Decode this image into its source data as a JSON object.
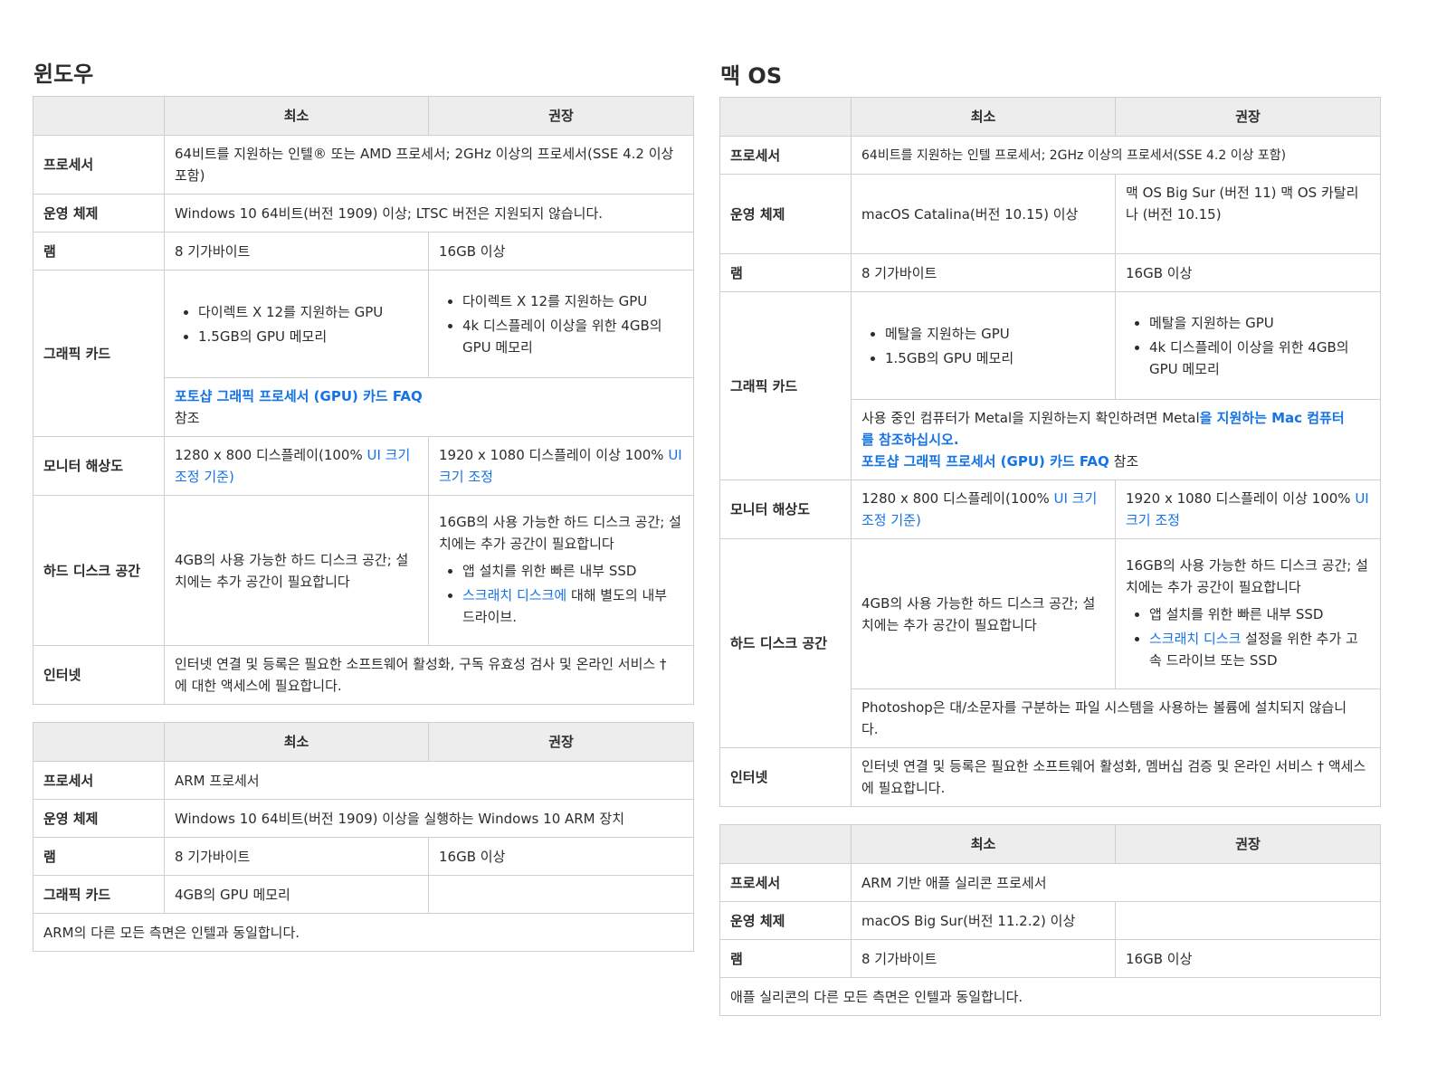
{
  "windows": {
    "heading": "윈도우",
    "col_min": "최소",
    "col_rec": "권장",
    "processor_label": "프로세서",
    "processor": "64비트를 지원하는 인텔® 또는 AMD 프로세서; 2GHz 이상의 프로세서(SSE 4.2 이상 포함)",
    "os_label": "운영 체제",
    "os": "Windows 10 64비트(버전 1909) 이상; LTSC 버전은 지원되지 않습니다.",
    "ram_label": "램",
    "ram_min": "8 기가바이트",
    "ram_rec": "16GB 이상",
    "gpu_label": "그래픽 카드",
    "gpu_min": [
      "다이렉트 X 12를 지원하는 GPU",
      "1.5GB의 GPU 메모리"
    ],
    "gpu_rec": [
      "다이렉트 X 12를 지원하는 GPU",
      "4k 디스플레이 이상을 위한 4GB의 GPU 메모리"
    ],
    "gpu_faq_link": "포토샵 그래픽 프로세서 (GPU) 카드 FAQ",
    "gpu_faq_suffix": "참조",
    "monitor_label": "모니터 해상도",
    "monitor_min_text": "1280 x 800 디스플레이(100% ",
    "monitor_min_link": "UI 크기 조정 기준)",
    "monitor_rec_text": "1920 x 1080 디스플레이 이상 100% ",
    "monitor_rec_link": "UI 크기 조정",
    "disk_label": "하드 디스크 공간",
    "disk_min": "4GB의 사용 가능한 하드 디스크 공간; 설치에는 추가 공간이 필요합니다",
    "disk_rec": "16GB의 사용 가능한 하드 디스크 공간; 설치에는 추가 공간이 필요합니다",
    "disk_rec_item1": "앱 설치를 위한 빠른 내부 SSD",
    "disk_rec_item2_link": "스크래치 디스크에",
    "disk_rec_item2_text": " 대해 별도의 내부 드라이브.",
    "internet_label": "인터넷",
    "internet": "인터넷 연결 및 등록은 필요한 소프트웨어 활성화, 구독 유효성 검사 및 온라인 서비스 †에 대한 액세스에 필요합니다."
  },
  "windows_arm": {
    "col_min": "최소",
    "col_rec": "권장",
    "processor_label": "프로세서",
    "processor": "ARM 프로세서",
    "os_label": "운영 체제",
    "os": "Windows 10 64비트(버전 1909) 이상을 실행하는 Windows 10 ARM 장치",
    "ram_label": "램",
    "ram_min": "8 기가바이트",
    "ram_rec": "16GB 이상",
    "gpu_label": "그래픽 카드",
    "gpu_min": "4GB의 GPU 메모리",
    "footer": "ARM의 다른 모든 측면은 인텔과 동일합니다."
  },
  "mac": {
    "heading": "맥 OS",
    "col_min": "최소",
    "col_rec": "권장",
    "processor_label": "프로세서",
    "processor": "64비트를 지원하는 인텔 프로세서; 2GHz 이상의 프로세서(SSE 4.2 이상 포함)",
    "os_label": "운영 체제",
    "os_min": "macOS Catalina(버전 10.15) 이상",
    "os_rec": "맥 OS Big Sur (버전 11) 맥 OS 카탈리나 (버전 10.15)",
    "ram_label": "램",
    "ram_min": "8 기가바이트",
    "ram_rec": "16GB 이상",
    "gpu_label": "그래픽 카드",
    "gpu_min": [
      "메탈을 지원하는 GPU",
      "1.5GB의 GPU 메모리"
    ],
    "gpu_rec": [
      "메탈을 지원하는 GPU",
      "4k 디스플레이 이상을 위한 4GB의 GPU 메모리"
    ],
    "gpu_note_text": "사용 중인 컴퓨터가 Metal을 지원하는지 확인하려면 Metal",
    "gpu_note_link": "을 지원하는 Mac 컴퓨터를 참조하십시오.",
    "gpu_faq_link": "포토샵 그래픽 프로세서 (GPU) 카드 FAQ",
    "gpu_faq_suffix": " 참조",
    "monitor_label": "모니터 해상도",
    "monitor_min_text": "1280 x 800 디스플레이(100% ",
    "monitor_min_link": "UI 크기 조정 기준)",
    "monitor_rec_text": "1920 x 1080 디스플레이 이상 100% ",
    "monitor_rec_link": "UI 크기 조정",
    "disk_label": "하드 디스크 공간",
    "disk_min": "4GB의 사용 가능한 하드 디스크 공간; 설치에는 추가 공간이 필요합니다",
    "disk_rec": "16GB의 사용 가능한 하드 디스크 공간; 설치에는 추가 공간이 필요합니다",
    "disk_rec_item1": "앱 설치를 위한 빠른 내부 SSD",
    "disk_rec_item2_link": "스크래치 디스크",
    "disk_rec_item2_text": " 설정을 위한 추가 고속 드라이브 또는 SSD",
    "disk_note": "Photoshop은 대/소문자를 구분하는 파일 시스템을 사용하는 볼륨에 설치되지 않습니다.",
    "internet_label": "인터넷",
    "internet": "인터넷 연결 및 등록은 필요한 소프트웨어 활성화, 멤버십 검증 및 온라인 서비스 † 액세스에 필요합니다."
  },
  "mac_arm": {
    "col_min": "최소",
    "col_rec": "권장",
    "processor_label": "프로세서",
    "processor": "ARM 기반 애플 실리콘 프로세서",
    "os_label": "운영 체제",
    "os": "macOS Big Sur(버전 11.2.2) 이상",
    "ram_label": "램",
    "ram_min": "8 기가바이트",
    "ram_rec": "16GB 이상",
    "footer": "애플 실리콘의 다른 모든 측면은 인텔과 동일합니다."
  }
}
